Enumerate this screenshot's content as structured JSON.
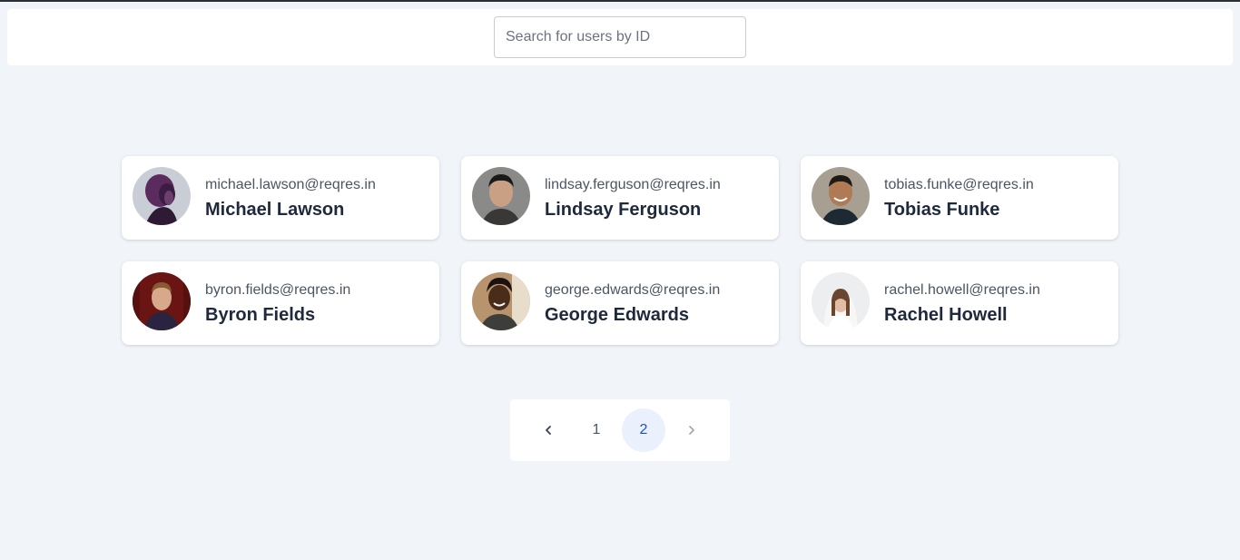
{
  "search": {
    "placeholder": "Search for users by ID"
  },
  "users": [
    {
      "email": "michael.lawson@reqres.in",
      "name": "Michael Lawson",
      "avatar_icon": "user-avatar-michael-lawson"
    },
    {
      "email": "lindsay.ferguson@reqres.in",
      "name": "Lindsay Ferguson",
      "avatar_icon": "user-avatar-lindsay-ferguson"
    },
    {
      "email": "tobias.funke@reqres.in",
      "name": "Tobias Funke",
      "avatar_icon": "user-avatar-tobias-funke"
    },
    {
      "email": "byron.fields@reqres.in",
      "name": "Byron Fields",
      "avatar_icon": "user-avatar-byron-fields"
    },
    {
      "email": "george.edwards@reqres.in",
      "name": "George Edwards",
      "avatar_icon": "user-avatar-george-edwards"
    },
    {
      "email": "rachel.howell@reqres.in",
      "name": "Rachel Howell",
      "avatar_icon": "user-avatar-rachel-howell"
    }
  ],
  "pagination": {
    "prev_icon": "chevron-left-icon",
    "pages": [
      "1",
      "2"
    ],
    "current_page": "2",
    "next_icon": "chevron-right-icon"
  },
  "colors": {
    "background": "#f1f4f8",
    "card": "#ffffff",
    "active_page_bg": "#eaf1fd",
    "active_page_text": "#1d4ed8",
    "name_text": "#1e293b",
    "email_text": "#4b5563"
  }
}
